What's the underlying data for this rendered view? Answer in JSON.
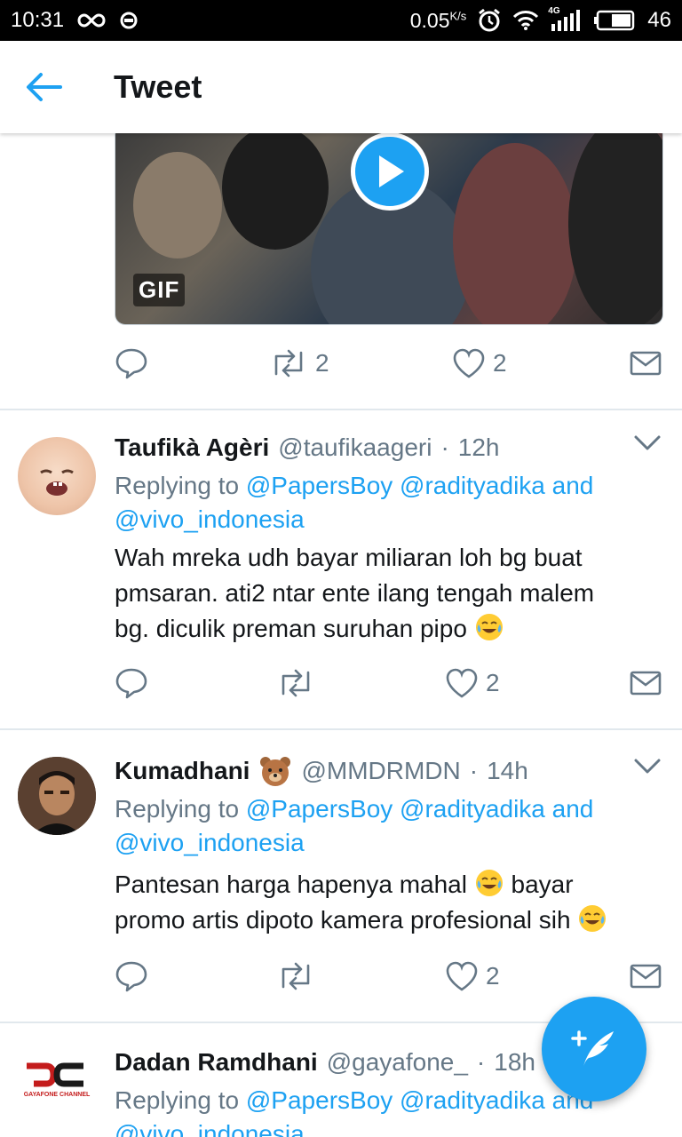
{
  "status_bar": {
    "time": "10:31",
    "speed": "0.05",
    "speed_unit": "K/s",
    "network": "4G",
    "battery": "46",
    "icons": [
      "infinity-icon",
      "sync-icon",
      "alarm-icon",
      "wifi-icon",
      "signal-icon",
      "battery-icon"
    ]
  },
  "app_bar": {
    "title": "Tweet",
    "back_icon": "arrow-left-icon"
  },
  "media": {
    "badge": "GIF",
    "play_icon": "play-icon"
  },
  "top_actions": {
    "retweet_count": "2",
    "like_count": "2"
  },
  "tweets": [
    {
      "name": "Taufikà Agèri",
      "handle": "@taufikaageri",
      "sep": "·",
      "time": "12h",
      "replying_prefix": "Replying to ",
      "replying_users": "@PapersBoy @radityadika and",
      "replying_users2": "@vivo_indonesia",
      "text_line1": "Wah mreka udh bayar miliaran loh bg buat",
      "text_line2": "pmsaran. ati2 ntar ente ilang tengah malem",
      "text_line3": "bg. diculik preman suruhan pipo",
      "retweet_count": "",
      "like_count": "2"
    },
    {
      "name": "Kumadhani",
      "handle": "@MMDRMDN",
      "sep": "·",
      "time": "14h",
      "replying_prefix": "Replying to ",
      "replying_users": "@PapersBoy @radityadika and",
      "replying_users2": "@vivo_indonesia",
      "text_line1": "Pantesan harga hapenya mahal",
      "text_line1b": "bayar",
      "text_line2": "promo artis dipoto kamera profesional sih",
      "retweet_count": "",
      "like_count": "2"
    },
    {
      "name": "Dadan Ramdhani",
      "handle": "@gayafone_",
      "sep": "·",
      "time": "18h",
      "replying_prefix": "Replying to ",
      "replying_users": "@PapersBoy @radityadika and",
      "replying_users2": "@vivo_indonesia",
      "avatar_logo_text": "GAYAFONE CHANNEL"
    }
  ],
  "colors": {
    "accent": "#1da1f2",
    "text": "#14171a",
    "muted": "#657786",
    "divider": "#e1e8ed"
  }
}
